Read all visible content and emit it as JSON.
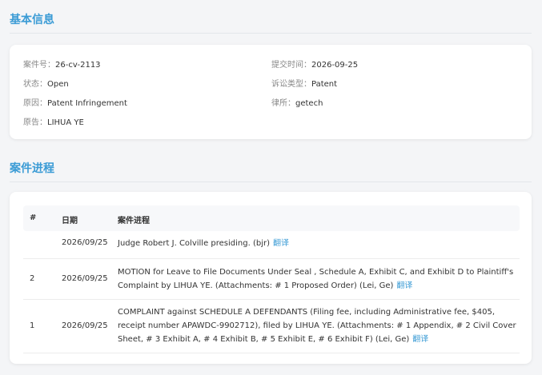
{
  "basic_info": {
    "title": "基本信息",
    "case_no": {
      "label": "案件号：",
      "value": "26-cv-2113"
    },
    "submit_time": {
      "label": "提交时间：",
      "value": "2026-09-25"
    },
    "status": {
      "label": "状态：",
      "value": "Open"
    },
    "case_type": {
      "label": "诉讼类型：",
      "value": "Patent"
    },
    "cause": {
      "label": "原因：",
      "value": "Patent Infringement"
    },
    "law_firm": {
      "label": "律所：",
      "value": "getech"
    },
    "plaintiff": {
      "label": "原告：",
      "value": "LIHUA YE"
    }
  },
  "progress": {
    "title": "案件进程",
    "headers": {
      "idx": "#",
      "date": "日期",
      "text": "案件进程"
    },
    "translate_label": "翻译",
    "rows": [
      {
        "idx": "",
        "date": "2026/09/25",
        "text": "Judge Robert J. Colville presiding. (bjr)"
      },
      {
        "idx": "2",
        "date": "2026/09/25",
        "text": "MOTION for Leave to File Documents Under Seal , Schedule A, Exhibit C, and Exhibit D to Plaintiff's Complaint by LIHUA YE. (Attachments: # 1 Proposed Order) (Lei, Ge)"
      },
      {
        "idx": "1",
        "date": "2026/09/25",
        "text": "COMPLAINT against SCHEDULE A DEFENDANTS (Filing fee, including Administrative fee, $405, receipt number APAWDC-9902712), filed by LIHUA YE. (Attachments: # 1 Appendix, # 2 Civil Cover Sheet, # 3 Exhibit A, # 4 Exhibit B, # 5 Exhibit E, # 6 Exhibit F) (Lei, Ge)"
      }
    ]
  }
}
